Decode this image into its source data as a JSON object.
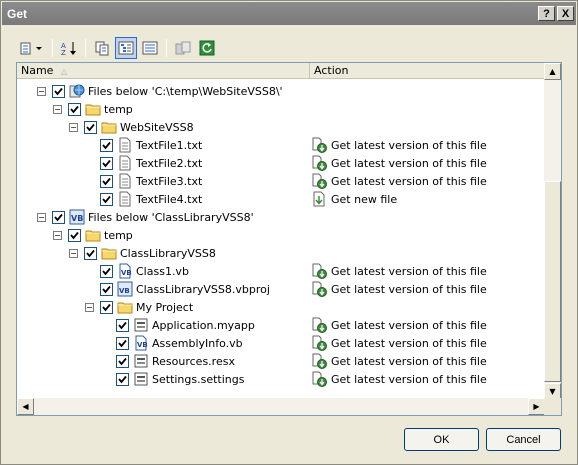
{
  "window": {
    "title": "Get",
    "help_btn": "?",
    "close_btn": "X"
  },
  "toolbar": {
    "items": [
      {
        "name": "view-options-icon",
        "pressed": false
      },
      {
        "name": "sort-icon",
        "pressed": false
      },
      {
        "name": "copy-icon",
        "pressed": false
      },
      {
        "name": "tree-view-icon",
        "pressed": true
      },
      {
        "name": "list-view-icon",
        "pressed": false
      },
      {
        "name": "compare-icon",
        "pressed": false
      },
      {
        "name": "refresh-icon",
        "pressed": false
      }
    ]
  },
  "columns": {
    "name": "Name",
    "action": "Action"
  },
  "rows": [
    {
      "level": 0,
      "type": "project-web",
      "expand": "minus",
      "label": "Files below 'C:\\temp\\WebSiteVSS8\\'",
      "action": ""
    },
    {
      "level": 1,
      "type": "folder",
      "expand": "minus",
      "label": "temp",
      "action": ""
    },
    {
      "level": 2,
      "type": "folder",
      "expand": "minus",
      "label": "WebSiteVSS8",
      "action": ""
    },
    {
      "level": 3,
      "type": "txt",
      "expand": "",
      "label": "TextFile1.txt",
      "action": "Get latest version of this file",
      "actionType": "latest"
    },
    {
      "level": 3,
      "type": "txt",
      "expand": "",
      "label": "TextFile2.txt",
      "action": "Get latest version of this file",
      "actionType": "latest"
    },
    {
      "level": 3,
      "type": "txt",
      "expand": "",
      "label": "TextFile3.txt",
      "action": "Get latest version of this file",
      "actionType": "latest"
    },
    {
      "level": 3,
      "type": "txt",
      "expand": "",
      "label": "TextFile4.txt",
      "action": "Get new file",
      "actionType": "new"
    },
    {
      "level": 0,
      "type": "project-vb",
      "expand": "minus",
      "label": "Files below 'ClassLibraryVSS8'",
      "action": ""
    },
    {
      "level": 1,
      "type": "folder",
      "expand": "minus",
      "label": "temp",
      "action": ""
    },
    {
      "level": 2,
      "type": "folder",
      "expand": "minus",
      "label": "ClassLibraryVSS8",
      "action": ""
    },
    {
      "level": 3,
      "type": "vb",
      "expand": "",
      "label": "Class1.vb",
      "action": "Get latest version of this file",
      "actionType": "latest"
    },
    {
      "level": 3,
      "type": "vbproj",
      "expand": "",
      "label": "ClassLibraryVSS8.vbproj",
      "action": "Get latest version of this file",
      "actionType": "latest"
    },
    {
      "level": 3,
      "type": "folder",
      "expand": "minus",
      "label": "My Project",
      "action": ""
    },
    {
      "level": 4,
      "type": "res",
      "expand": "",
      "label": "Application.myapp",
      "action": "Get latest version of this file",
      "actionType": "latest"
    },
    {
      "level": 4,
      "type": "vb",
      "expand": "",
      "label": "AssemblyInfo.vb",
      "action": "Get latest version of this file",
      "actionType": "latest"
    },
    {
      "level": 4,
      "type": "res",
      "expand": "",
      "label": "Resources.resx",
      "action": "Get latest version of this file",
      "actionType": "latest"
    },
    {
      "level": 4,
      "type": "res",
      "expand": "",
      "label": "Settings.settings",
      "action": "Get latest version of this file",
      "actionType": "latest"
    }
  ],
  "buttons": {
    "ok": "OK",
    "cancel": "Cancel"
  },
  "colors": {
    "selection": "#316ac5",
    "border": "#7f9db9",
    "dialog_bg": "#ece9d8"
  }
}
